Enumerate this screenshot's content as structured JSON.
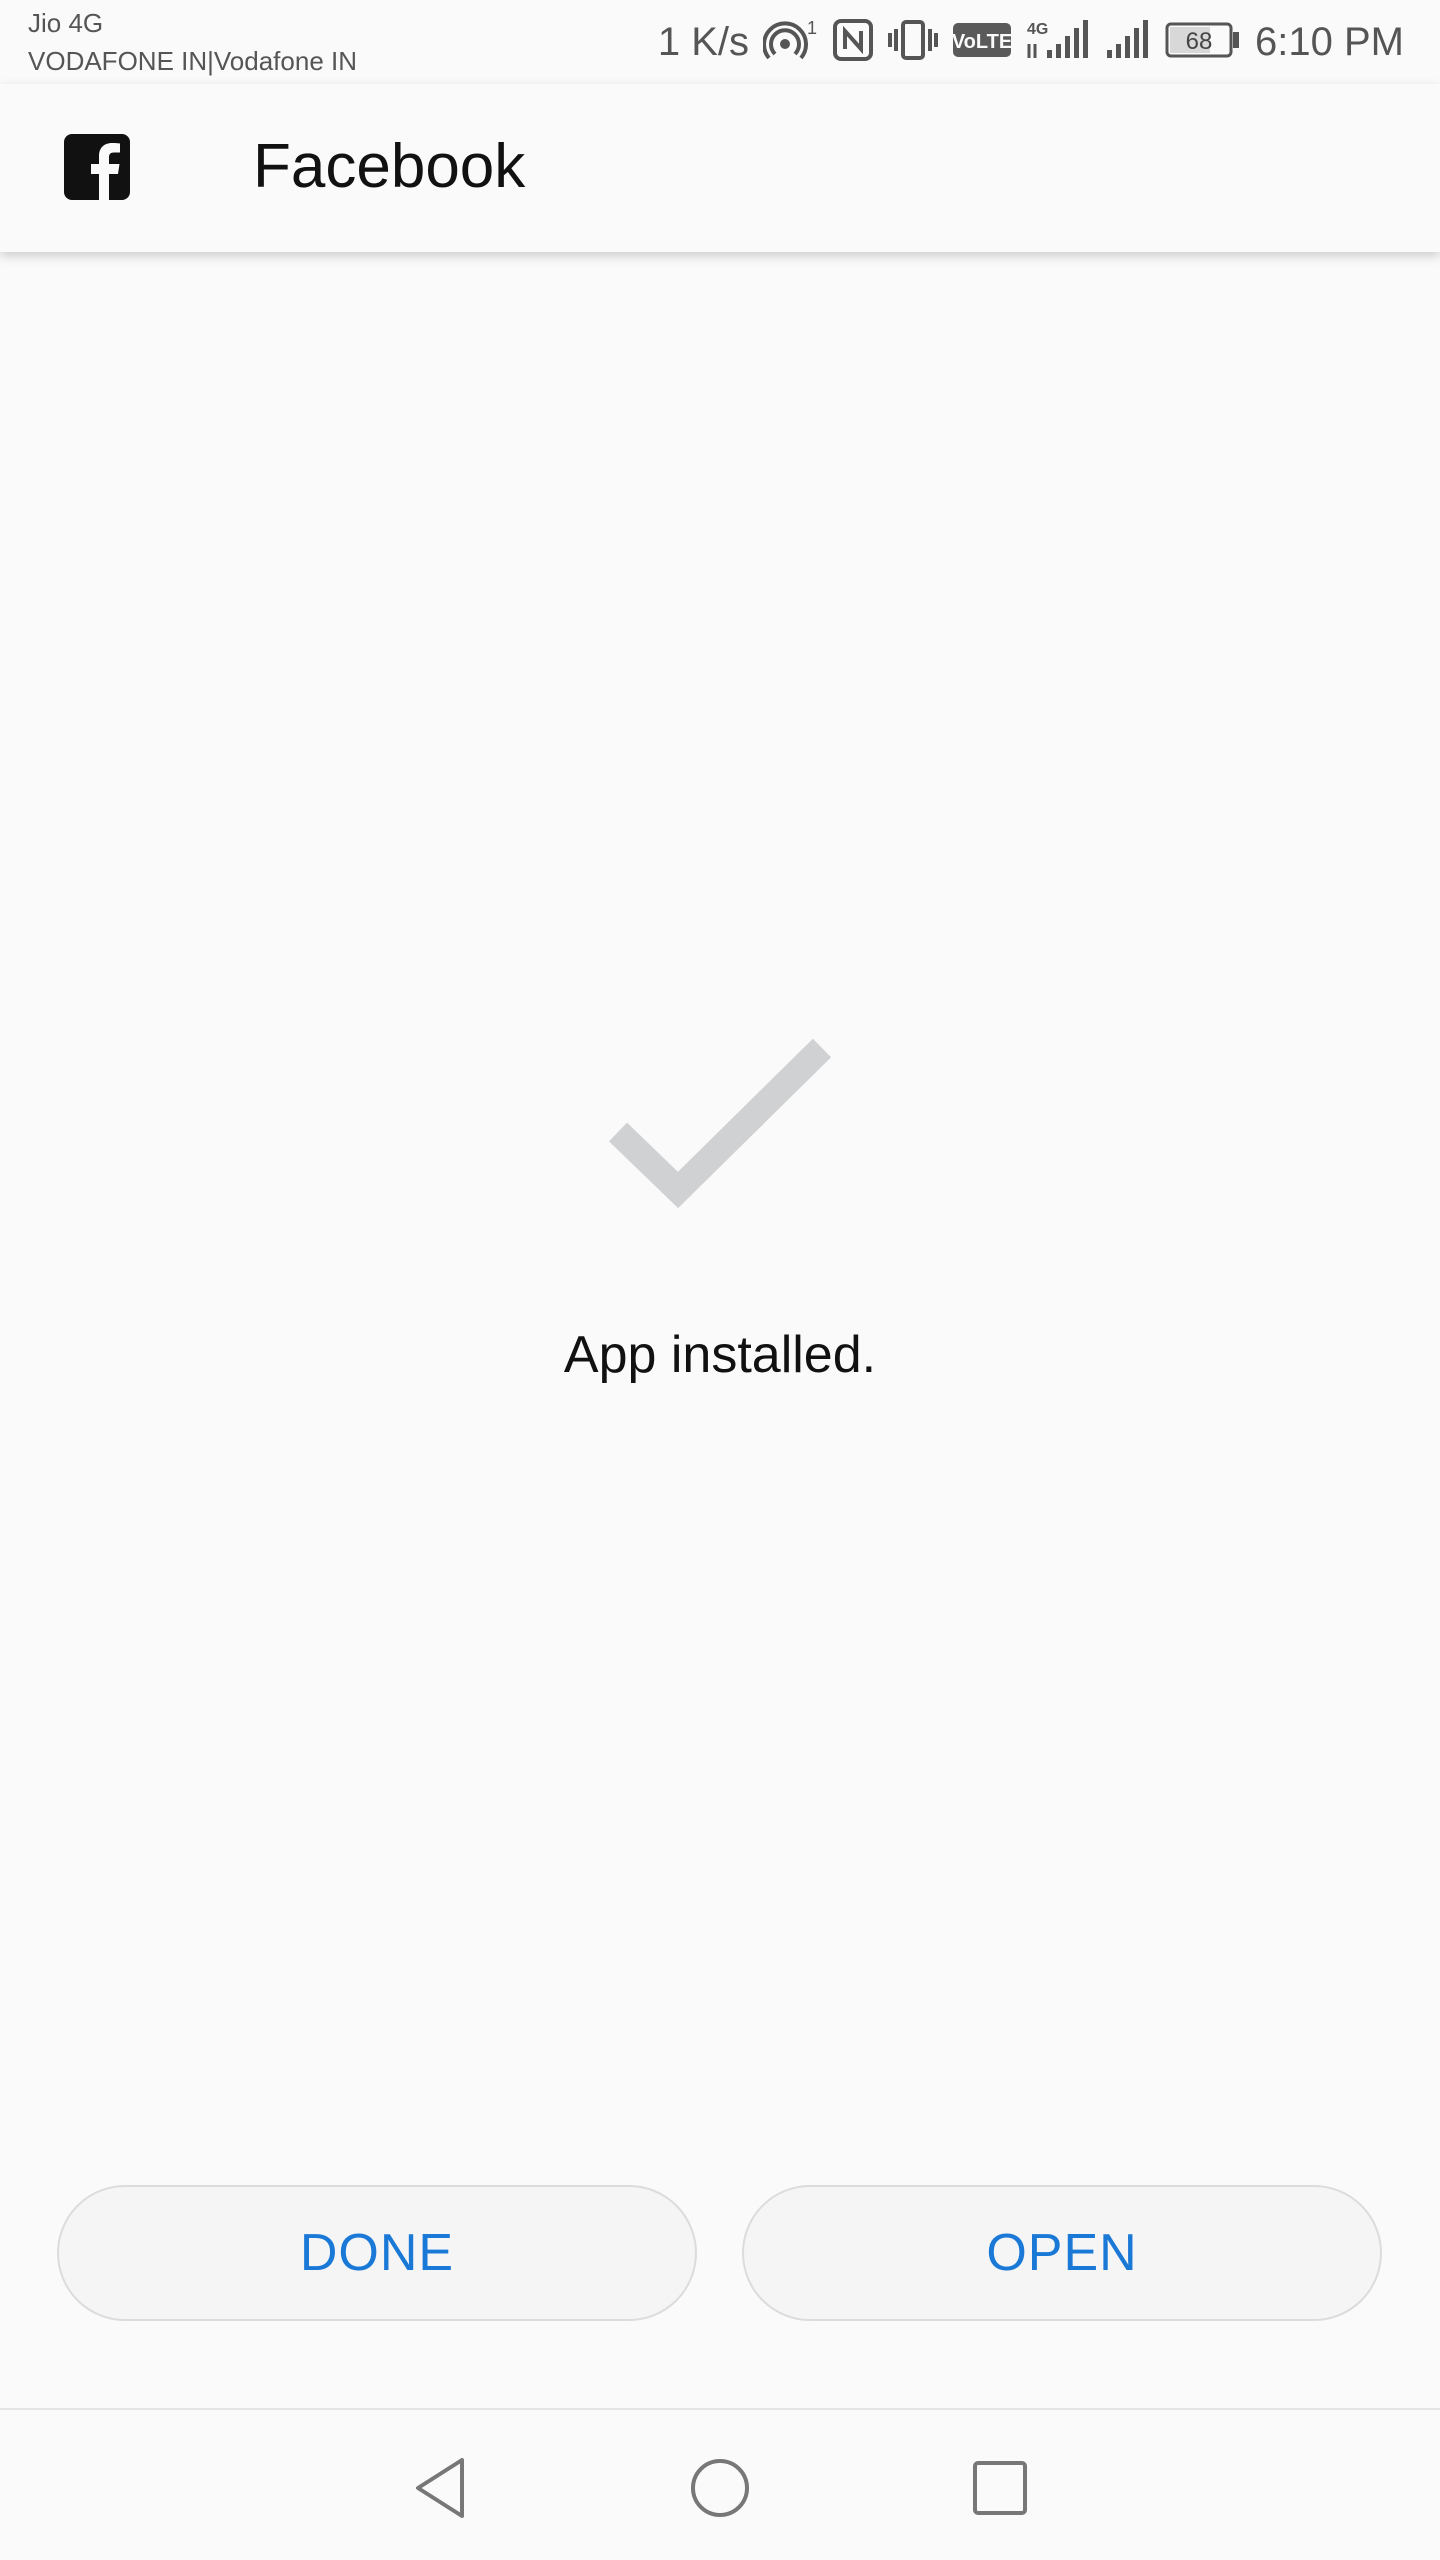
{
  "status_bar": {
    "carrier_line_1": "Jio 4G",
    "carrier_line_2": "VODAFONE IN|Vodafone IN",
    "network_speed": "1 K/s",
    "hotspot_count": "1",
    "volte_label": "VoLTE",
    "data_type": "4G",
    "battery_level": "68",
    "time": "6:10 PM",
    "icons": [
      "hotspot-icon",
      "nfc-icon",
      "vibrate-icon",
      "volte-icon",
      "signal-4g-icon",
      "signal-icon",
      "battery-icon"
    ]
  },
  "app_bar": {
    "title": "Facebook",
    "logo_icon": "facebook-logo-icon"
  },
  "content": {
    "status_icon": "checkmark-icon",
    "message": "App installed."
  },
  "buttons": {
    "done_label": "DONE",
    "open_label": "OPEN"
  },
  "navigation": {
    "back_icon": "back-triangle-icon",
    "home_icon": "home-circle-icon",
    "recents_icon": "recents-square-icon"
  },
  "colors": {
    "background": "#fafafa",
    "accent": "#1a78d6",
    "check_gray": "#cfd1d3",
    "text": "#111111"
  }
}
